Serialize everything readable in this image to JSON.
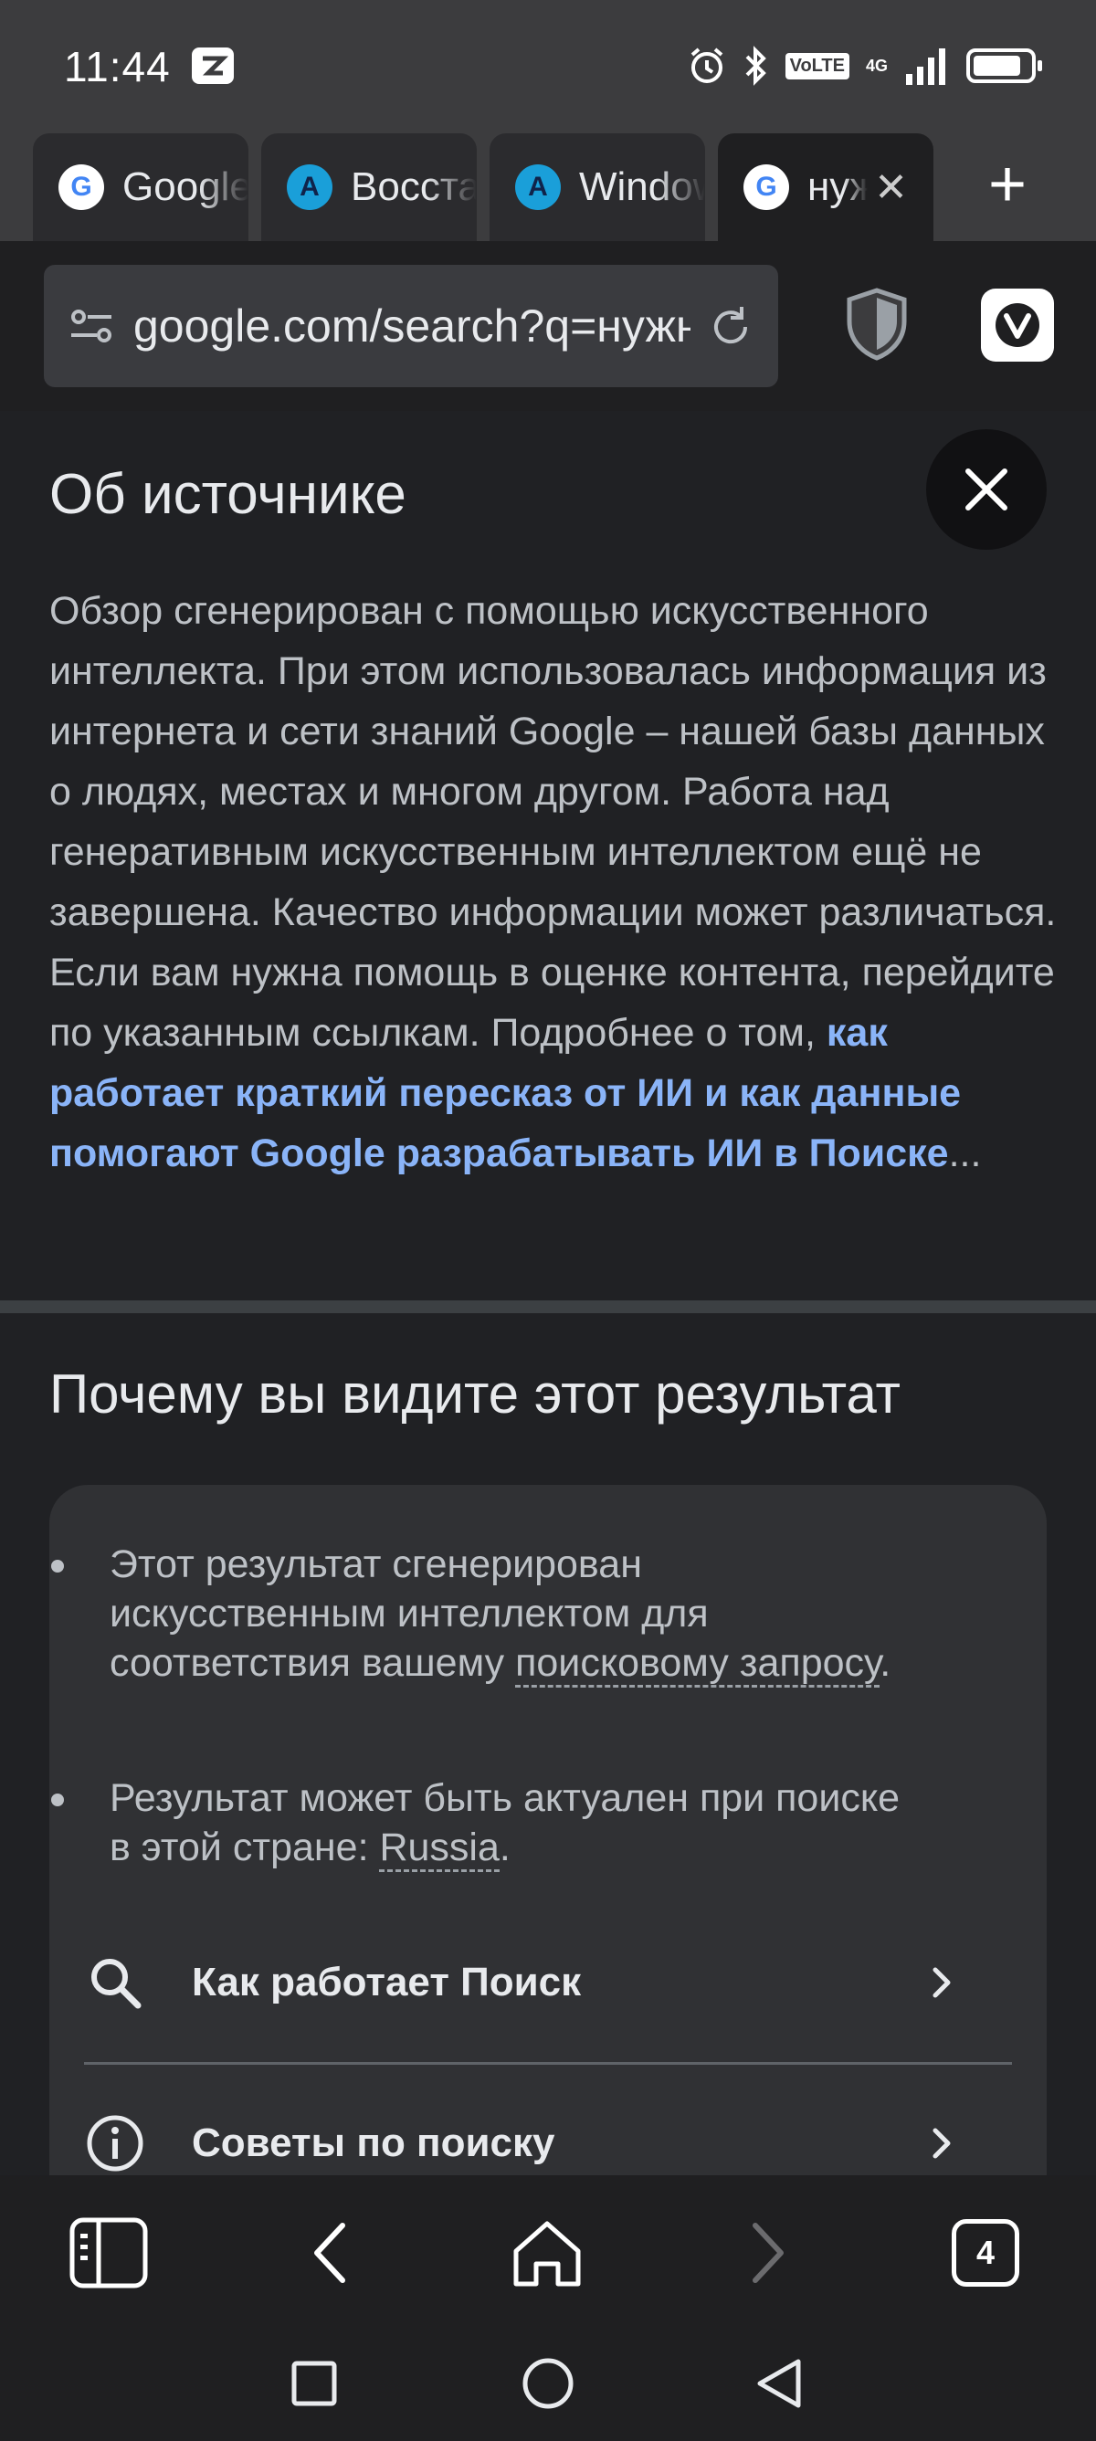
{
  "status_bar": {
    "time": "11:44",
    "volte": "VoLTE",
    "network": "4G",
    "battery_level": 0.85,
    "icons": [
      "alarm-icon",
      "bluetooth-icon",
      "signal-icon",
      "battery-icon"
    ]
  },
  "tabs": [
    {
      "title": "Google",
      "favicon": "G",
      "active": false
    },
    {
      "title": "Восстановление",
      "favicon": "A",
      "active": false
    },
    {
      "title": "Windows",
      "favicon": "A",
      "active": false
    },
    {
      "title": "нужно",
      "favicon": "G",
      "active": true
    }
  ],
  "address_bar": {
    "url": "google.com/search?q=нужно"
  },
  "about": {
    "title": "Об источнике",
    "body": "Обзор сгенерирован с помощью искусственного интеллекта. При этом использовалась информация из интернета и сети знаний Google – нашей базы данных о людях, местах и многом другом. Работа над генеративным искусственным интеллектом ещё не завершена. Качество информации может различаться. Если вам нужна помощь в оценке контента, перейдите по указанным ссылкам. Подробнее о том, ",
    "link": "как работает краткий пересказ от ИИ и как данные помогают Google разрабатывать ИИ в Поиске",
    "ellipsis": "..."
  },
  "why": {
    "title": "Почему вы видите этот результат",
    "bullet1_text": "Этот результат сгенерирован искусственным интеллектом для соответствия вашему ",
    "bullet1_term": "поисковому запросу",
    "bullet1_end": ".",
    "bullet2_text": "Результат может быть актуален при поиске в этой стране: ",
    "bullet2_term": "Russia",
    "bullet2_end": ".",
    "row1_label": "Как работает Поиск",
    "row2_label": "Советы по поиску"
  },
  "bottom_toolbar": {
    "tab_count": "4"
  },
  "colors": {
    "link": "#8ab4f8",
    "background": "#202124",
    "card": "#303134"
  }
}
